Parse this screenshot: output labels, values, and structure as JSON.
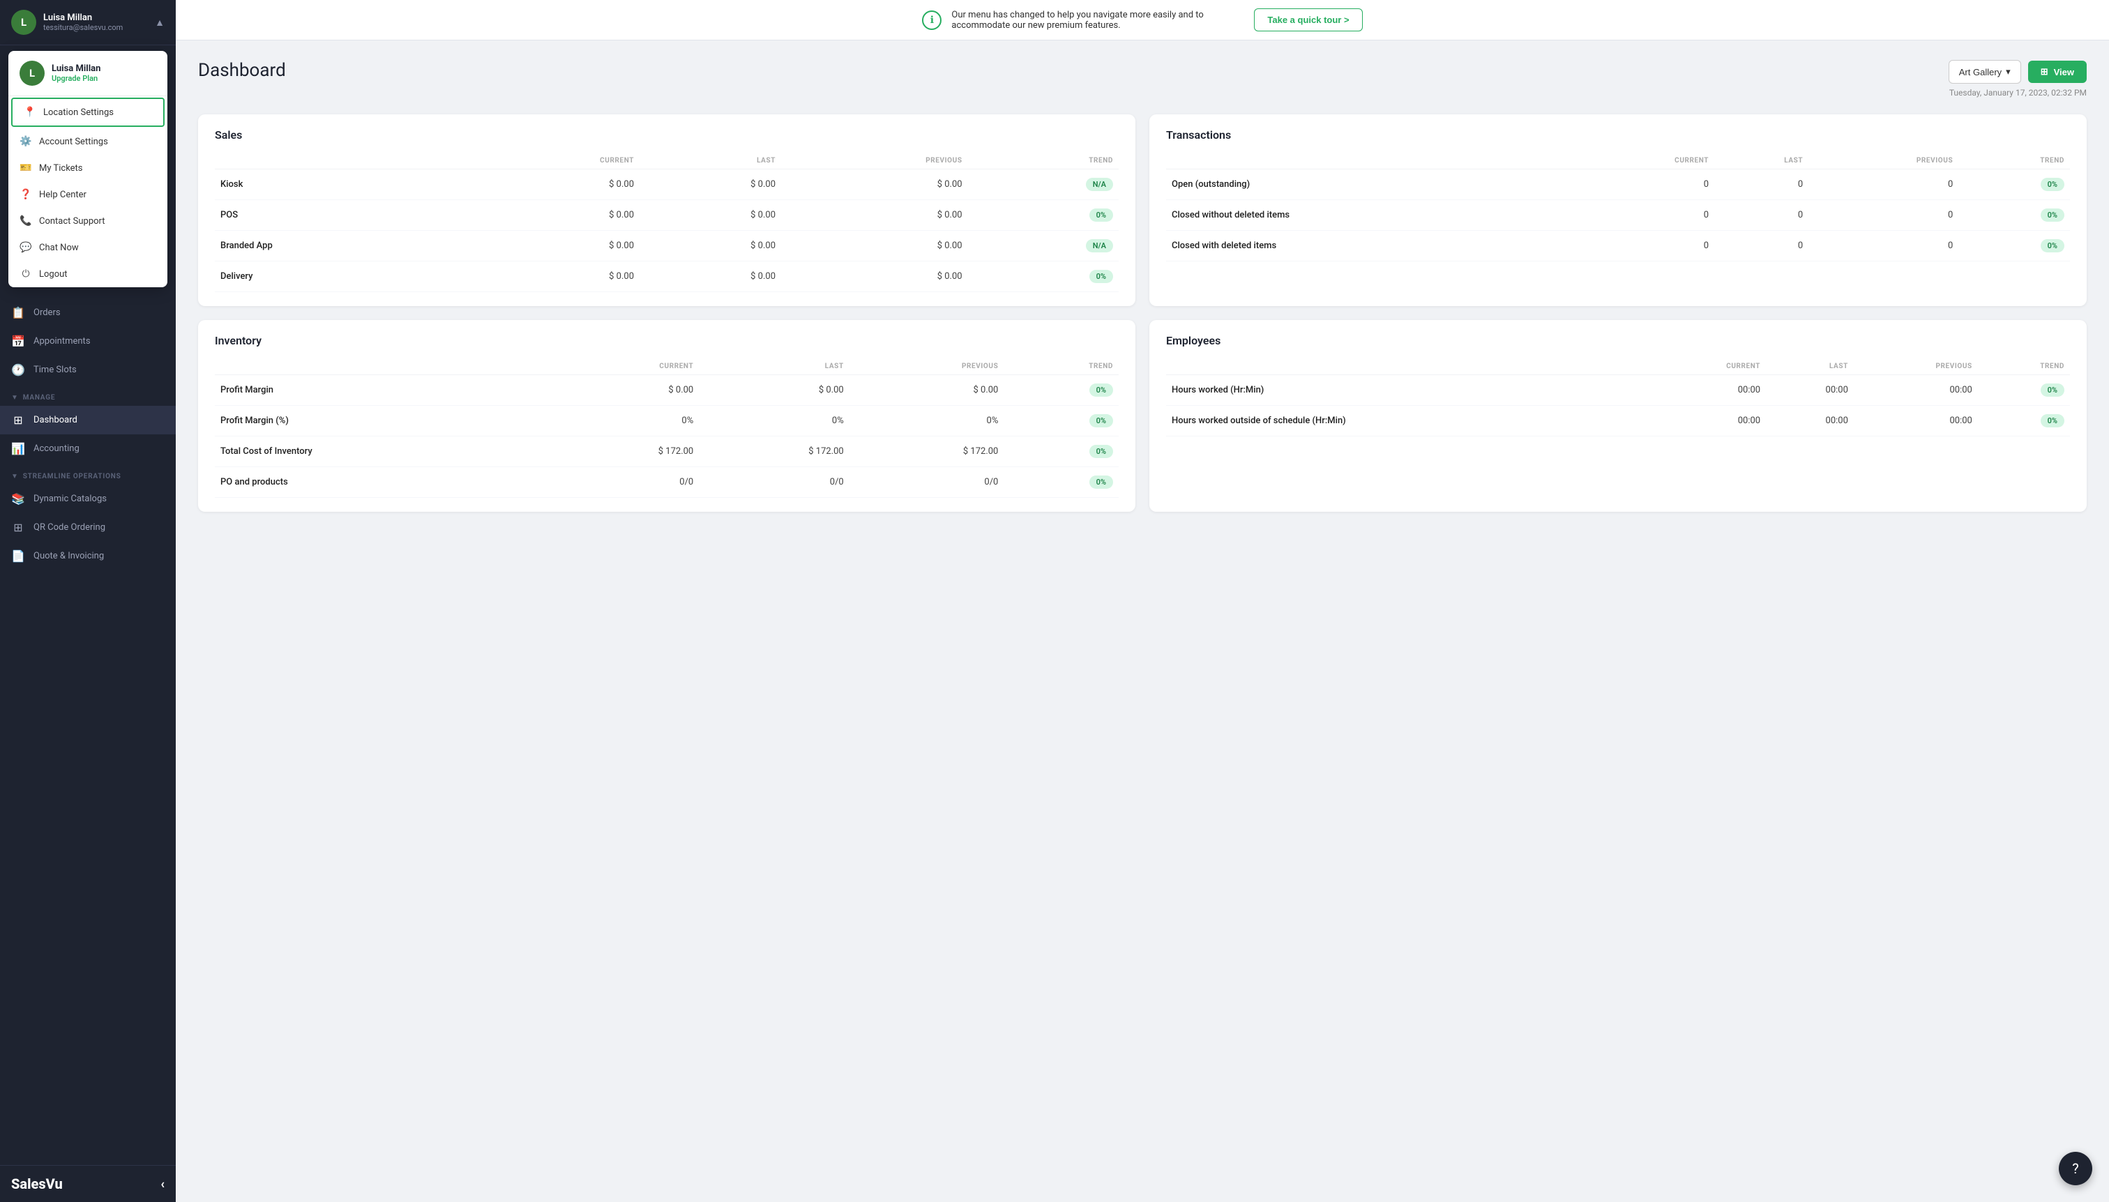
{
  "sidebar": {
    "user": {
      "name": "Luisa Millan",
      "email": "tessitura@salesvu.com",
      "avatar_initial": "L",
      "upgrade_label": "Upgrade Plan"
    },
    "dropdown": {
      "items": [
        {
          "id": "location-settings",
          "label": "Location Settings",
          "icon": "📍",
          "active": true
        },
        {
          "id": "account-settings",
          "label": "Account Settings",
          "icon": "⚙️",
          "active": false
        },
        {
          "id": "my-tickets",
          "label": "My Tickets",
          "icon": "🎫",
          "active": false
        },
        {
          "id": "help-center",
          "label": "Help Center",
          "icon": "❓",
          "active": false
        },
        {
          "id": "contact-support",
          "label": "Contact Support",
          "icon": "📞",
          "active": false
        },
        {
          "id": "chat-now",
          "label": "Chat Now",
          "icon": "💬",
          "active": false
        },
        {
          "id": "logout",
          "label": "Logout",
          "icon": "⏻",
          "active": false
        }
      ]
    },
    "nav_items": [
      {
        "id": "orders",
        "label": "Orders",
        "icon": "📋"
      },
      {
        "id": "appointments",
        "label": "Appointments",
        "icon": "📅"
      },
      {
        "id": "time-slots",
        "label": "Time Slots",
        "icon": "🕐"
      }
    ],
    "manage_section": {
      "label": "MANAGE",
      "items": [
        {
          "id": "dashboard",
          "label": "Dashboard",
          "icon": "⊞",
          "active": true
        },
        {
          "id": "accounting",
          "label": "Accounting",
          "icon": "📊",
          "active": false
        }
      ]
    },
    "streamline_section": {
      "label": "STREAMLINE OPERATIONS",
      "items": [
        {
          "id": "dynamic-catalogs",
          "label": "Dynamic Catalogs",
          "icon": "📚"
        },
        {
          "id": "qr-code-ordering",
          "label": "QR Code Ordering",
          "icon": "⊞"
        },
        {
          "id": "quote-invoicing",
          "label": "Quote & Invoicing",
          "icon": "📄"
        }
      ]
    },
    "logo": "SalesVu",
    "collapse_icon": "‹"
  },
  "banner": {
    "text": "Our menu has changed to help you navigate more easily and to accommodate our new premium features.",
    "tour_button": "Take a quick tour >"
  },
  "dashboard": {
    "title": "Dashboard",
    "location_button": "Art Gallery",
    "view_button": "View",
    "date": "Tuesday, January 17, 2023, 02:32 PM",
    "sales_card": {
      "title": "Sales",
      "headers": [
        "",
        "CURRENT",
        "LAST",
        "PREVIOUS",
        "TREND"
      ],
      "rows": [
        {
          "label": "Kiosk",
          "current": "$ 0.00",
          "last": "$ 0.00",
          "previous": "$ 0.00",
          "trend": "N/A"
        },
        {
          "label": "POS",
          "current": "$ 0.00",
          "last": "$ 0.00",
          "previous": "$ 0.00",
          "trend": "0%"
        },
        {
          "label": "Branded App",
          "current": "$ 0.00",
          "last": "$ 0.00",
          "previous": "$ 0.00",
          "trend": "N/A"
        },
        {
          "label": "Delivery",
          "current": "$ 0.00",
          "last": "$ 0.00",
          "previous": "$ 0.00",
          "trend": "0%"
        }
      ]
    },
    "transactions_card": {
      "title": "Transactions",
      "headers": [
        "",
        "CURRENT",
        "LAST",
        "PREVIOUS",
        "TREND"
      ],
      "rows": [
        {
          "label": "Open (outstanding)",
          "current": "0",
          "last": "0",
          "previous": "0",
          "trend": "0%"
        },
        {
          "label": "Closed without deleted items",
          "current": "0",
          "last": "0",
          "previous": "0",
          "trend": "0%"
        },
        {
          "label": "Closed with deleted items",
          "current": "0",
          "last": "0",
          "previous": "0",
          "trend": "0%"
        }
      ]
    },
    "inventory_card": {
      "title": "Inventory",
      "headers": [
        "",
        "CURRENT",
        "LAST",
        "PREVIOUS",
        "TREND"
      ],
      "rows": [
        {
          "label": "Profit Margin",
          "current": "$ 0.00",
          "last": "$ 0.00",
          "previous": "$ 0.00",
          "trend": "0%"
        },
        {
          "label": "Profit Margin (%)",
          "current": "0%",
          "last": "0%",
          "previous": "0%",
          "trend": "0%"
        },
        {
          "label": "Total Cost of Inventory",
          "current": "$ 172.00",
          "last": "$ 172.00",
          "previous": "$ 172.00",
          "trend": "0%"
        },
        {
          "label": "PO and products",
          "current": "0/0",
          "last": "0/0",
          "previous": "0/0",
          "trend": "0%"
        }
      ]
    },
    "employees_card": {
      "title": "Employees",
      "headers": [
        "",
        "CURRENT",
        "LAST",
        "PREVIOUS",
        "TREND"
      ],
      "rows": [
        {
          "label": "Hours worked (Hr:Min)",
          "current": "00:00",
          "last": "00:00",
          "previous": "00:00",
          "trend": "0%"
        },
        {
          "label": "Hours worked outside of schedule (Hr:Min)",
          "current": "00:00",
          "last": "00:00",
          "previous": "00:00",
          "trend": "0%"
        }
      ]
    }
  },
  "help_button": "?"
}
